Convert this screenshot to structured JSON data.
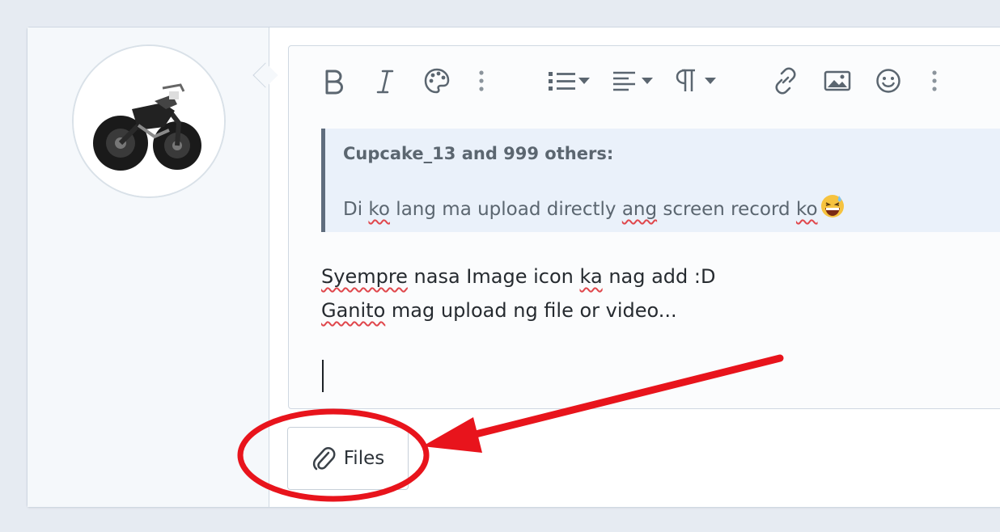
{
  "toolbar": {
    "buttons": [
      {
        "name": "bold",
        "icon": "bold-icon"
      },
      {
        "name": "italic",
        "icon": "italic-icon"
      },
      {
        "name": "text-color",
        "icon": "palette-icon"
      },
      {
        "name": "more-text",
        "icon": "more-vertical-icon"
      },
      {
        "name": "list",
        "icon": "list-icon"
      },
      {
        "name": "align",
        "icon": "align-icon"
      },
      {
        "name": "paragraph",
        "icon": "paragraph-icon"
      },
      {
        "name": "link",
        "icon": "link-icon"
      },
      {
        "name": "image",
        "icon": "image-icon"
      },
      {
        "name": "emoji",
        "icon": "smile-icon"
      },
      {
        "name": "more-insert",
        "icon": "more-vertical-icon"
      }
    ]
  },
  "quote": {
    "author": "Cupcake_13 and 999 others:",
    "text_parts": [
      "Di ",
      "ko",
      " lang ma upload directly ",
      "ang",
      " screen record ",
      "ko"
    ]
  },
  "message": {
    "line1_parts": [
      "Syempre",
      " nasa Image icon ",
      "ka",
      " nag add :D"
    ],
    "line2_parts": [
      "Ganito",
      " mag upload ng file or video..."
    ]
  },
  "files_button": {
    "label": "Files",
    "icon": "paperclip-icon"
  },
  "colors": {
    "annotation": "#e8141c",
    "accent_text": "#5b6670",
    "spellcheck": "#e0474c"
  }
}
